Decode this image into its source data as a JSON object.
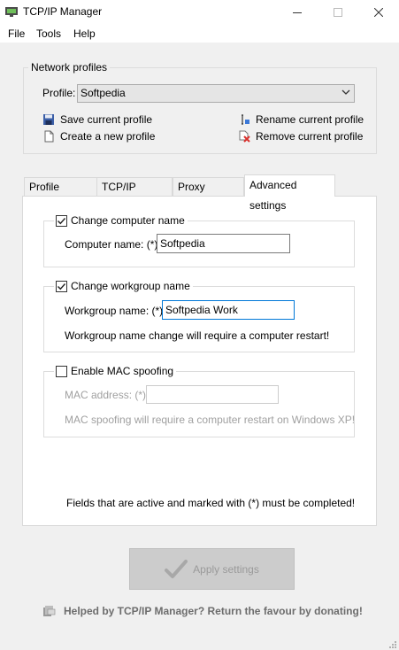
{
  "window": {
    "title": "TCP/IP Manager"
  },
  "menu": {
    "file": "File",
    "tools": "Tools",
    "help": "Help"
  },
  "network_profiles": {
    "legend": "Network profiles",
    "profile_label": "Profile:",
    "profile_value": "Softpedia",
    "save": "Save current profile",
    "create": "Create a new profile",
    "rename": "Rename current profile",
    "remove": "Remove current profile"
  },
  "tabs": [
    {
      "label": "Profile settings"
    },
    {
      "label": "TCP/IP settings"
    },
    {
      "label": "Proxy settings"
    },
    {
      "label": "Advanced settings",
      "active": true
    }
  ],
  "advanced": {
    "computer_name": {
      "checkbox_label": "Change computer name",
      "checked": true,
      "field_label": "Computer name: (*)",
      "value": "Softpedia"
    },
    "workgroup": {
      "checkbox_label": "Change workgroup name",
      "checked": true,
      "field_label": "Workgroup name: (*)",
      "value": "Softpedia Work",
      "note": "Workgroup name change will require a computer restart!"
    },
    "mac": {
      "checkbox_label": "Enable MAC spoofing",
      "checked": false,
      "field_label": "MAC address: (*)",
      "value": "",
      "note": "MAC spoofing will require a computer restart on Windows XP!"
    },
    "required_note": "Fields that are active and marked with (*) must be completed!"
  },
  "apply_label": "Apply settings",
  "donate_text": "Helped by TCP/IP Manager? Return the favour by donating!",
  "colors": {
    "accent": "#0078d7",
    "disabled_text": "#a0a0a0",
    "remove_red": "#d9302c"
  },
  "icons": [
    "app-icon",
    "minimize-icon",
    "maximize-icon",
    "close-icon",
    "chevron-down-icon",
    "floppy-disk-icon",
    "new-document-icon",
    "rename-icon",
    "remove-icon",
    "checkmark-icon",
    "donate-icon",
    "resize-grip-icon"
  ]
}
